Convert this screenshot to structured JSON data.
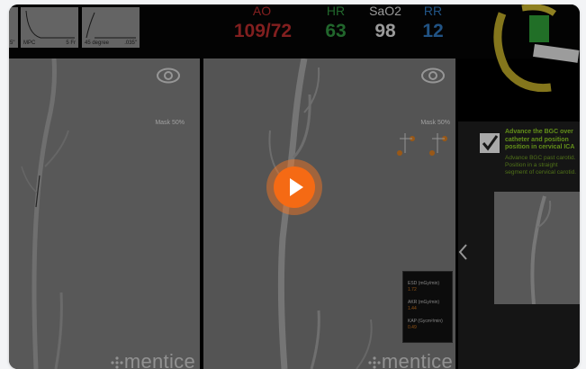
{
  "vitals": [
    {
      "label": "AO",
      "value": "109/72",
      "color": "#b42b2b"
    },
    {
      "label": "HR",
      "value": "63",
      "color": "#2f8e3d"
    },
    {
      "label": "SaO2",
      "value": "98",
      "color": "#d6d6d6"
    },
    {
      "label": "RR",
      "value": "12",
      "color": "#2e74b8"
    }
  ],
  "tools": {
    "thumb1": {
      "left": "5\"",
      "right": ""
    },
    "thumb2": {
      "left": "MPC",
      "right": "5 Fr"
    },
    "thumb3": {
      "left": "45 degree",
      "right": ".035\""
    }
  },
  "panes": [
    {
      "mask": "Mask 50%",
      "brand": "mentice",
      "icon": "eye-icon"
    },
    {
      "mask": "Mask 50%",
      "brand": "mentice",
      "icon": "eye-icon"
    }
  ],
  "metrics": [
    {
      "label": "ESD (mGy/min)",
      "value": "1.72"
    },
    {
      "label": "AKR (mGy/min)",
      "value": "1.44"
    },
    {
      "label": "KAP (Gycm²/min)",
      "value": "0.49"
    }
  ],
  "task": {
    "heading": "Advance the BGC over catheter and position position in cervical ICA",
    "detail": "Advance BGC past carotid. Position in a straight segment of cervical carotid."
  },
  "video": {
    "play_icon": "play-icon",
    "accent": "#f56a14"
  },
  "colors": {
    "task_green": "#89c623"
  }
}
